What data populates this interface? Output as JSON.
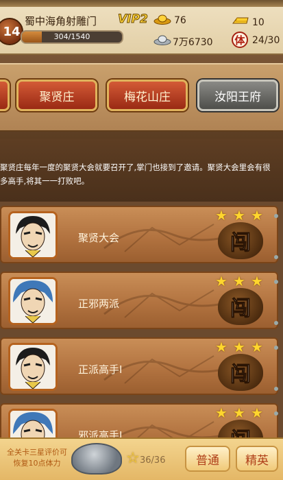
{
  "player": {
    "level": "14",
    "name": "蜀中海角射雕门",
    "exp": "304/1540",
    "exp_fraction": 0.197,
    "vip": "VIP2"
  },
  "resources": {
    "gold": "76",
    "silver": "7万6730",
    "ingot": "10",
    "stamina": "24/30",
    "stamina_glyph": "体",
    "gold_icon": "gold-ingot-icon",
    "silver_icon": "silver-ingot-icon",
    "ingot_icon": "gold-bar-icon"
  },
  "tabs": [
    {
      "label": "",
      "style": "red"
    },
    {
      "label": "聚贤庄",
      "style": "red"
    },
    {
      "label": "梅花山庄",
      "style": "red"
    },
    {
      "label": "汝阳王府",
      "style": "gray"
    }
  ],
  "description": "聚贤庄每年一度的聚贤大会就要召开了,掌门也接到了邀请。聚贤大会里会有很多高手,将其一一打败吧。",
  "stages": [
    {
      "name": "聚贤大会",
      "stars": 3,
      "action": "闯",
      "portrait": "black-hair-swordsman-portrait"
    },
    {
      "name": "正邪两派",
      "stars": 3,
      "action": "闯",
      "portrait": "blue-helmet-warrior-portrait"
    },
    {
      "name": "正派高手Ⅰ",
      "stars": 3,
      "action": "闯",
      "portrait": "black-hair-swordsman-portrait"
    },
    {
      "name": "邪派高手Ⅰ",
      "stars": 3,
      "action": "闯",
      "portrait": "blue-helmet-warrior-portrait"
    }
  ],
  "bottom": {
    "info_line1": "全关卡三星评价可",
    "info_line2": "恢复10点体力",
    "star_progress": "36/36",
    "normal_label": "普通",
    "elite_label": "精英"
  },
  "colors": {
    "accent_gold": "#ffd62e",
    "tab_red": "#b3381c",
    "tab_gray": "#6e6e6a"
  }
}
